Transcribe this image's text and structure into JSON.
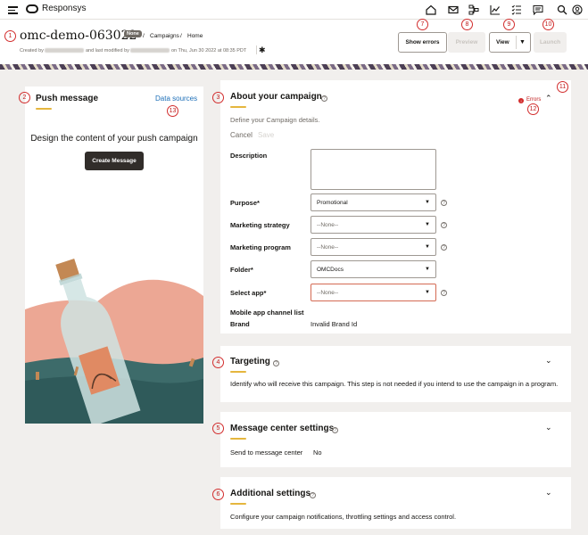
{
  "app": {
    "name": "Responsys"
  },
  "header": {
    "campaign_title": "omc-demo-063022",
    "badge": "None",
    "breadcrumb": [
      "Campaigns",
      "Home"
    ],
    "breadcrumb_sep": "/",
    "created_prefix": "Created by",
    "modified_prefix": "and last modified by",
    "modified_on": "on Thu, Jun 30 2022 at 08:35 PDT",
    "buttons": {
      "show_errors": "Show errors",
      "preview": "Preview",
      "view": "View",
      "launch": "Launch"
    }
  },
  "annotations": [
    "1",
    "2",
    "3",
    "4",
    "5",
    "6",
    "7",
    "8",
    "9",
    "10",
    "11",
    "12",
    "13"
  ],
  "push_message": {
    "title": "Push message",
    "data_sources": "Data sources",
    "design_text": "Design the content of your push campaign",
    "create_button": "Create Message"
  },
  "about": {
    "title": "About your campaign",
    "errors": "Errors",
    "subtitle": "Define your Campaign details.",
    "cancel": "Cancel",
    "save": "Save",
    "fields": {
      "description": "Description",
      "purpose": {
        "label": "Purpose*",
        "value": "Promotional"
      },
      "strategy": {
        "label": "Marketing strategy",
        "value": "--None--"
      },
      "program": {
        "label": "Marketing program",
        "value": "--None--"
      },
      "folder": {
        "label": "Folder*",
        "value": "OMCDocs"
      },
      "app": {
        "label": "Select app*",
        "value": "--None--"
      },
      "channel_list": "Mobile app channel list",
      "brand": {
        "label": "Brand",
        "value": "Invalid Brand Id"
      }
    }
  },
  "targeting": {
    "title": "Targeting",
    "text": "Identify who will receive this campaign. This step is not needed if you intend to use the campaign in a program."
  },
  "message_center": {
    "title": "Message center settings",
    "label": "Send to message center",
    "value": "No"
  },
  "additional": {
    "title": "Additional settings",
    "text": "Configure your campaign notifications, throttling settings and access control."
  },
  "colors": {
    "accent_yellow": "#e5b63d",
    "annotation_red": "#d22d2d",
    "link_blue": "#1d6fb8"
  }
}
